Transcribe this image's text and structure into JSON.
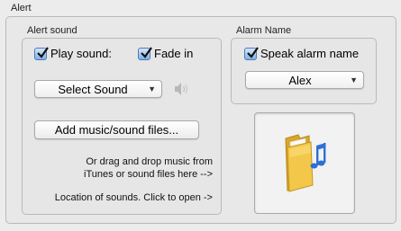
{
  "alert": {
    "group_title": "Alert",
    "sound_group": {
      "title": "Alert sound",
      "play_sound": {
        "label": "Play sound:",
        "checked": true
      },
      "fade_in": {
        "label": "Fade in",
        "checked": true
      },
      "select_sound": {
        "value": "Select Sound"
      },
      "add_files_button": "Add music/sound files...",
      "drag_hint": [
        "Or drag and drop music from",
        "iTunes or sound files here -->"
      ],
      "location_hint": "Location of sounds. Click to open ->"
    },
    "alarm_name_group": {
      "title": "Alarm Name",
      "speak_alarm_name": {
        "label": "Speak alarm name",
        "checked": true
      },
      "voice_select": {
        "value": "Alex"
      }
    },
    "icons": {
      "volume": "speaker-icon",
      "sounds_folder": "music-folder-icon"
    },
    "colors": {
      "checkbox_accent": "#4d7ab9",
      "folder_yellow": "#f0c040",
      "music_note_blue": "#2f6fd6"
    }
  }
}
